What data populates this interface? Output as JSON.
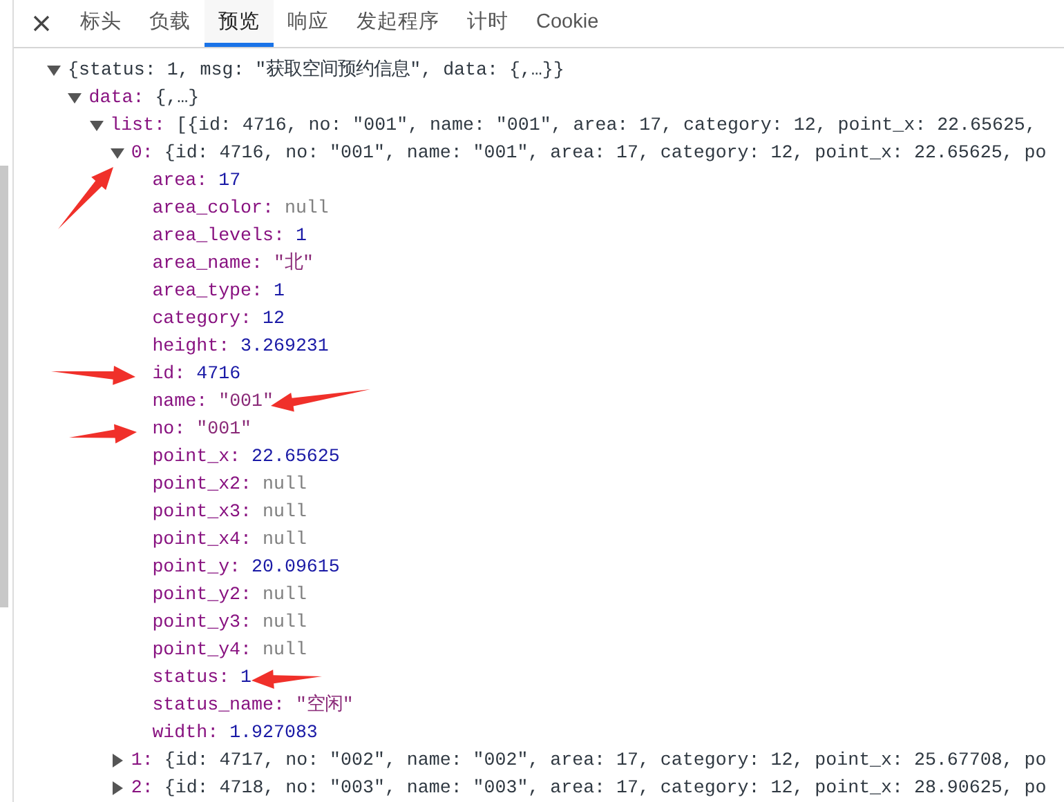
{
  "tabs": [
    {
      "label": "标头",
      "selected": false
    },
    {
      "label": "负载",
      "selected": false
    },
    {
      "label": "预览",
      "selected": true
    },
    {
      "label": "响应",
      "selected": false
    },
    {
      "label": "发起程序",
      "selected": false
    },
    {
      "label": "计时",
      "selected": false
    },
    {
      "label": "Cookie",
      "selected": false
    }
  ],
  "tree": [
    {
      "summary": "{status: 1, msg: \"获取空间预约信息\", data: {,…}}",
      "expanded": true,
      "children": [
        {
          "key": "data:",
          "summary": "{,…}",
          "expanded": true,
          "children": [
            {
              "key": "list:",
              "summary": "[{id: 4716, no: \"001\", name: \"001\", area: 17, category: 12, point_x: 22.65625,",
              "expanded": true,
              "children": [
                {
                  "key": "0:",
                  "summary": "{id: 4716, no: \"001\", name: \"001\", area: 17, category: 12, point_x: 22.65625, po",
                  "expanded": true,
                  "children": [
                    {
                      "key": "area:",
                      "value": "17",
                      "kind": "number"
                    },
                    {
                      "key": "area_color:",
                      "value": "null",
                      "kind": "null"
                    },
                    {
                      "key": "area_levels:",
                      "value": "1",
                      "kind": "number"
                    },
                    {
                      "key": "area_name:",
                      "value": "\"北\"",
                      "kind": "string"
                    },
                    {
                      "key": "area_type:",
                      "value": "1",
                      "kind": "number"
                    },
                    {
                      "key": "category:",
                      "value": "12",
                      "kind": "number"
                    },
                    {
                      "key": "height:",
                      "value": "3.269231",
                      "kind": "number"
                    },
                    {
                      "key": "id:",
                      "value": "4716",
                      "kind": "number"
                    },
                    {
                      "key": "name:",
                      "value": "\"001\"",
                      "kind": "string"
                    },
                    {
                      "key": "no:",
                      "value": "\"001\"",
                      "kind": "string"
                    },
                    {
                      "key": "point_x:",
                      "value": "22.65625",
                      "kind": "number"
                    },
                    {
                      "key": "point_x2:",
                      "value": "null",
                      "kind": "null"
                    },
                    {
                      "key": "point_x3:",
                      "value": "null",
                      "kind": "null"
                    },
                    {
                      "key": "point_x4:",
                      "value": "null",
                      "kind": "null"
                    },
                    {
                      "key": "point_y:",
                      "value": "20.09615",
                      "kind": "number"
                    },
                    {
                      "key": "point_y2:",
                      "value": "null",
                      "kind": "null"
                    },
                    {
                      "key": "point_y3:",
                      "value": "null",
                      "kind": "null"
                    },
                    {
                      "key": "point_y4:",
                      "value": "null",
                      "kind": "null"
                    },
                    {
                      "key": "status:",
                      "value": "1",
                      "kind": "number"
                    },
                    {
                      "key": "status_name:",
                      "value": "\"空闲\"",
                      "kind": "string"
                    },
                    {
                      "key": "width:",
                      "value": "1.927083",
                      "kind": "number"
                    }
                  ]
                },
                {
                  "key": "1:",
                  "summary": "{id: 4717, no: \"002\", name: \"002\", area: 17, category: 12, point_x: 25.67708, po",
                  "expanded": false
                },
                {
                  "key": "2:",
                  "summary": "{id: 4718, no: \"003\", name: \"003\", area: 17, category: 12, point_x: 28.90625, po",
                  "expanded": false
                }
              ]
            }
          ]
        }
      ]
    }
  ]
}
